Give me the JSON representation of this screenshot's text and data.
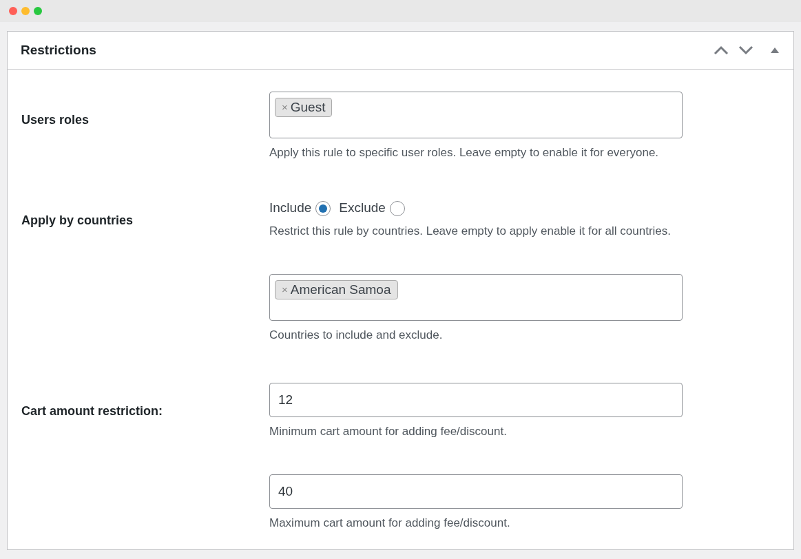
{
  "panel": {
    "title": "Restrictions"
  },
  "rows": [
    {
      "label": "Users roles",
      "controls": [
        {
          "kind": "tags",
          "tags": [
            {
              "remove": "×",
              "text": "Guest"
            }
          ],
          "description": "Apply this rule to specific user roles. Leave empty to enable it for everyone."
        }
      ]
    },
    {
      "label": "Apply by countries",
      "controls": [
        {
          "kind": "radios",
          "options": [
            {
              "label": "Include",
              "selected": true
            },
            {
              "label": "Exclude",
              "selected": false
            }
          ],
          "description": "Restrict this rule by countries. Leave empty to apply enable it for all countries."
        },
        {
          "kind": "tags",
          "tags": [
            {
              "remove": "×",
              "text": "American Samoa"
            }
          ],
          "description": "Countries to include and exclude."
        }
      ]
    },
    {
      "label": "Cart amount restriction:",
      "controls": [
        {
          "kind": "input",
          "value": "12",
          "description": "Minimum cart amount for adding fee/discount."
        },
        {
          "kind": "input",
          "value": "40",
          "description": "Maximum cart amount for adding fee/discount."
        }
      ]
    }
  ]
}
